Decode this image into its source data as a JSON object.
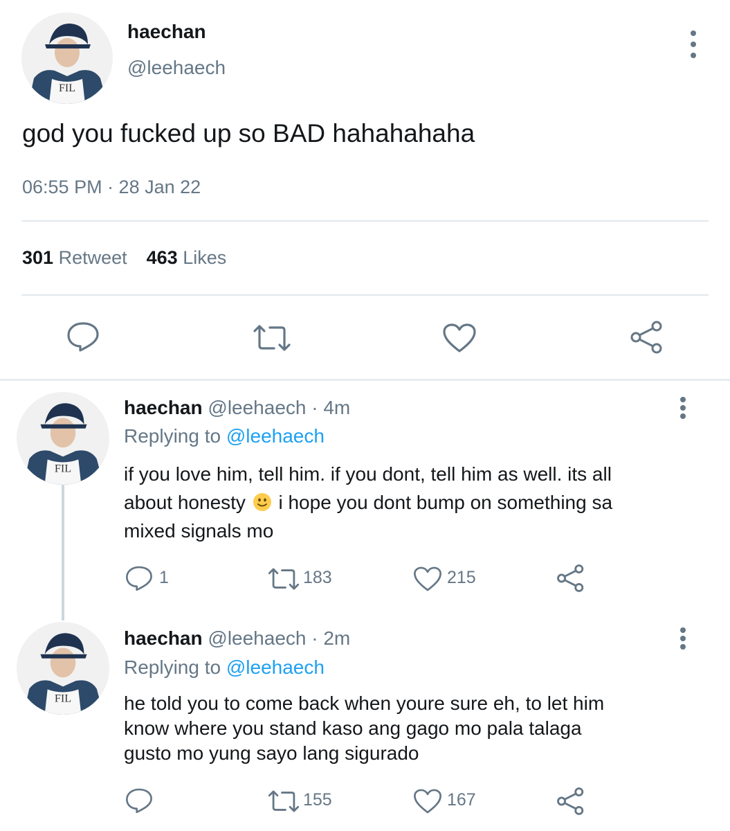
{
  "main_tweet": {
    "display_name": "haechan",
    "handle": "@leehaech",
    "avatar_shirt_text": "FIL",
    "text": "god you fucked up so BAD hahahahaha",
    "timestamp": "06:55 PM · 28 Jan 22",
    "retweet_count": "301",
    "retweet_label": "Retweet",
    "like_count": "463",
    "like_label": "Likes",
    "actions": [
      "reply-icon",
      "retweet-icon",
      "heart-icon",
      "share-icon"
    ]
  },
  "replies": [
    {
      "display_name": "haechan",
      "handle_time": "@leehaech · 4m",
      "replying_label": "Replying to",
      "replying_handle": "@leehaech",
      "avatar_shirt_text": "FIL",
      "line1": "if you love him, tell him. if you dont, tell him as well. its all",
      "line2a": "about honesty",
      "emoji": "slightly-smiling-face",
      "line2b": "i hope you dont bump on something sa",
      "line3": "mixed signals mo",
      "reply_count": "1",
      "retweet_count": "183",
      "like_count": "215"
    },
    {
      "display_name": "haechan",
      "handle_time": "@leehaech · 2m",
      "replying_label": "Replying to",
      "replying_handle": "@leehaech",
      "avatar_shirt_text": "FIL",
      "line1": "he told you to come back when youre sure eh, to let him",
      "line2": "know where you stand kaso ang gago mo pala talaga",
      "line3": "gusto mo yung sayo lang sigurado",
      "reply_count": "",
      "retweet_count": "155",
      "like_count": "167"
    }
  ],
  "colors": {
    "text_primary": "#14171a",
    "text_secondary": "#657786",
    "link": "#1da1f2",
    "divider": "#e1e8ed"
  }
}
